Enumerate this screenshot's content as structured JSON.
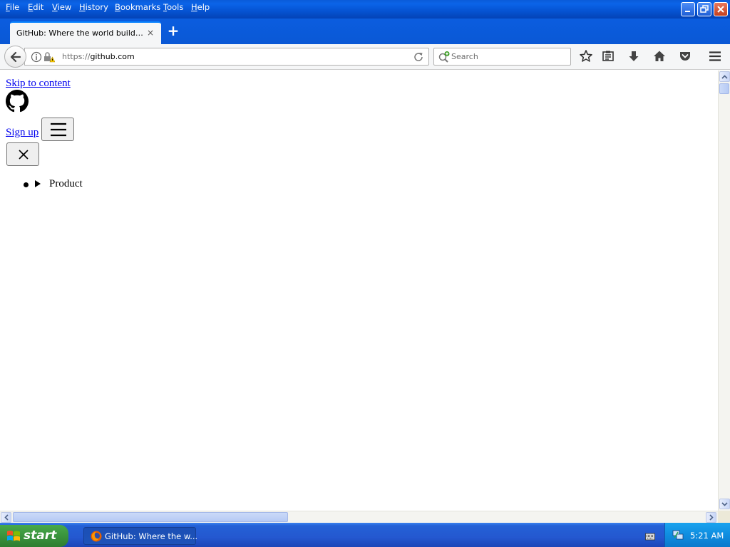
{
  "menubar": {
    "items": [
      "File",
      "Edit",
      "View",
      "History",
      "Bookmarks",
      "Tools",
      "Help"
    ]
  },
  "window_controls": {
    "minimize_icon": "minimize-icon",
    "restore_icon": "restore-icon",
    "close_icon": "close-icon"
  },
  "tabs": {
    "active": {
      "title": "GitHub: Where the world builds so...",
      "close_symbol": "×"
    },
    "new_tab_symbol": "+"
  },
  "navbar": {
    "url_scheme": "https://",
    "url_host": "github.com",
    "search_placeholder": "Search"
  },
  "page": {
    "skip_link": "Skip to content",
    "signup_link": "Sign up",
    "nav_items": [
      {
        "label": "Product"
      }
    ]
  },
  "taskbar": {
    "start_label": "start",
    "task_label": "GitHub: Where the w...",
    "clock": "5:21 AM"
  },
  "colors": {
    "link": "#0000ee",
    "xp_blue": "#0553d2",
    "start_green": "#3c983f"
  }
}
